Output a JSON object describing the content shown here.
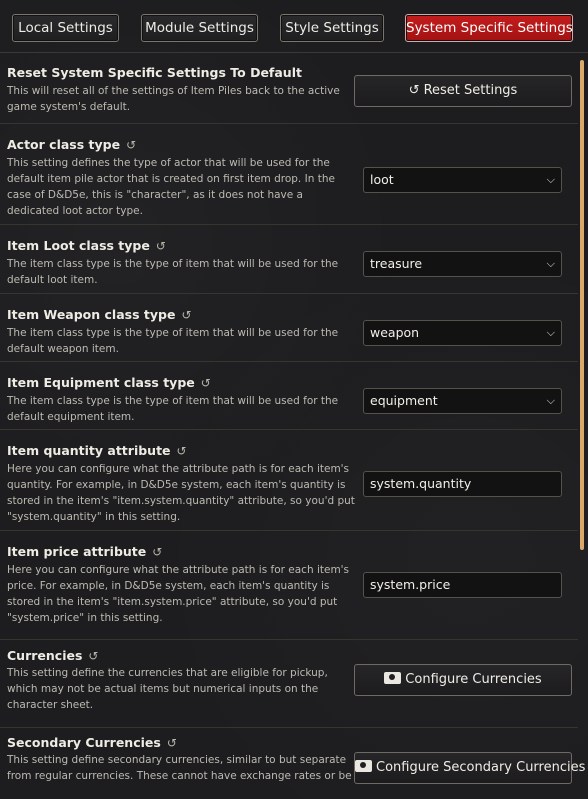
{
  "tabs": [
    {
      "label": "Local Settings",
      "active": false
    },
    {
      "label": "Module Settings",
      "active": false
    },
    {
      "label": "Style Settings",
      "active": false
    },
    {
      "label": "System Specific Settings",
      "active": true
    }
  ],
  "colors": {
    "active_tab": "#b41616",
    "scrollbar": "#d8a96a",
    "background": "#1d1d1f"
  },
  "settings": {
    "reset": {
      "title": "Reset System Specific Settings To Default",
      "hint": "This will reset all of the settings of Item Piles back to the active game system's default.",
      "button_label": "Reset Settings",
      "button_icon": "undo-icon"
    },
    "actor_class": {
      "title": "Actor class type",
      "hint": "This setting defines the type of actor that will be used for the default item pile actor that is created on first item drop. In the case of D&D5e, this is \"character\", as it does not have a dedicated loot actor type.",
      "value": "loot"
    },
    "item_loot_class": {
      "title": "Item Loot class type",
      "hint": "The item class type is the type of item that will be used for the default loot item.",
      "value": "treasure"
    },
    "item_weapon_class": {
      "title": "Item Weapon class type",
      "hint": "The item class type is the type of item that will be used for the default weapon item.",
      "value": "weapon"
    },
    "item_equipment_class": {
      "title": "Item Equipment class type",
      "hint": "The item class type is the type of item that will be used for the default equipment item.",
      "value": "equipment"
    },
    "item_quantity_attribute": {
      "title": "Item quantity attribute",
      "hint": "Here you can configure what the attribute path is for each item's quantity. For example, in D&D5e system, each item's quantity is stored in the item's \"item.system.quantity\" attribute, so you'd put \"system.quantity\" in this setting.",
      "value": "system.quantity"
    },
    "item_price_attribute": {
      "title": "Item price attribute",
      "hint": "Here you can configure what the attribute path is for each item's price. For example, in D&D5e system, each item's quantity is stored in the item's \"item.system.price\" attribute, so you'd put \"system.price\" in this setting.",
      "value": "system.price"
    },
    "currencies": {
      "title": "Currencies",
      "hint": "This setting define the currencies that are eligible for pickup, which may not be actual items but numerical inputs on the character sheet.",
      "button_label": "Configure Currencies",
      "button_icon": "money-bill-icon"
    },
    "secondary_currencies": {
      "title": "Secondary Currencies",
      "hint": "This setting define secondary currencies, similar to but separate from regular currencies. These cannot have exchange rates or be",
      "button_label": "Configure Secondary Currencies",
      "button_icon": "money-bill-icon"
    }
  },
  "reset_glyph": "↺",
  "select_chevron": "⌄"
}
